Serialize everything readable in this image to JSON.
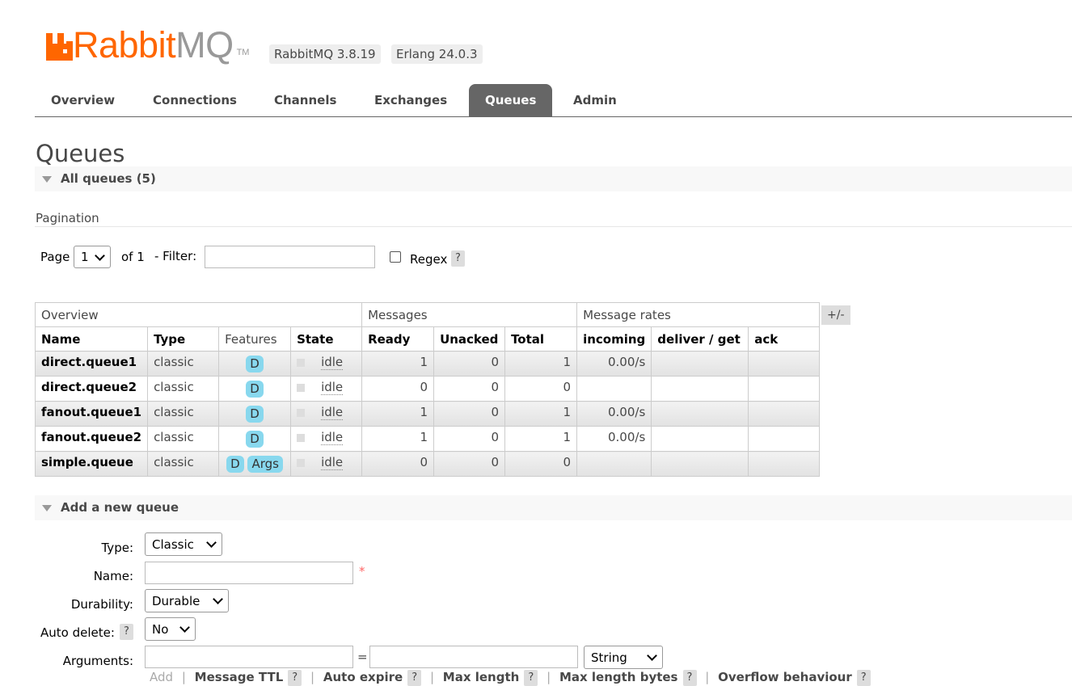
{
  "header": {
    "logo_rabbit": "Rabbit",
    "logo_mq": "MQ",
    "logo_tm": "TM",
    "version_badge": "RabbitMQ 3.8.19",
    "erlang_badge": "Erlang 24.0.3",
    "brand_color": "#ff6600"
  },
  "nav": {
    "tabs": [
      {
        "label": "Overview"
      },
      {
        "label": "Connections"
      },
      {
        "label": "Channels"
      },
      {
        "label": "Exchanges"
      },
      {
        "label": "Queues",
        "active": true
      },
      {
        "label": "Admin"
      }
    ]
  },
  "page_title": "Queues",
  "all_queues": {
    "title": "All queues (5)",
    "pagination_label": "Pagination",
    "page_label": "Page",
    "page_value": "1",
    "of_label": "of 1",
    "filter_label": "- Filter:",
    "filter_value": "",
    "regex_label": "Regex",
    "help": "?",
    "toggle_columns": "+/-",
    "groups": {
      "overview": "Overview",
      "messages": "Messages",
      "rates": "Message rates"
    },
    "columns": {
      "name": "Name",
      "type": "Type",
      "features": "Features",
      "state": "State",
      "ready": "Ready",
      "unacked": "Unacked",
      "total": "Total",
      "incoming": "incoming",
      "deliver": "deliver / get",
      "ack": "ack"
    },
    "rows": [
      {
        "name": "direct.queue1",
        "type": "classic",
        "features": [
          "D"
        ],
        "state": "idle",
        "ready": "1",
        "unacked": "0",
        "total": "1",
        "incoming": "0.00/s",
        "deliver": "",
        "ack": ""
      },
      {
        "name": "direct.queue2",
        "type": "classic",
        "features": [
          "D"
        ],
        "state": "idle",
        "ready": "0",
        "unacked": "0",
        "total": "0",
        "incoming": "",
        "deliver": "",
        "ack": ""
      },
      {
        "name": "fanout.queue1",
        "type": "classic",
        "features": [
          "D"
        ],
        "state": "idle",
        "ready": "1",
        "unacked": "0",
        "total": "1",
        "incoming": "0.00/s",
        "deliver": "",
        "ack": ""
      },
      {
        "name": "fanout.queue2",
        "type": "classic",
        "features": [
          "D"
        ],
        "state": "idle",
        "ready": "1",
        "unacked": "0",
        "total": "1",
        "incoming": "0.00/s",
        "deliver": "",
        "ack": ""
      },
      {
        "name": "simple.queue",
        "type": "classic",
        "features": [
          "D",
          "Args"
        ],
        "state": "idle",
        "ready": "0",
        "unacked": "0",
        "total": "0",
        "incoming": "",
        "deliver": "",
        "ack": ""
      }
    ]
  },
  "add_queue": {
    "title": "Add a new queue",
    "type_label": "Type:",
    "type_value": "Classic",
    "name_label": "Name:",
    "name_value": "",
    "required_mark": "*",
    "durability_label": "Durability:",
    "durability_value": "Durable",
    "auto_delete_label": "Auto delete:",
    "auto_delete_value": "No",
    "arguments_label": "Arguments:",
    "arg_key": "",
    "arg_eq": "=",
    "arg_value": "",
    "arg_type": "String",
    "add_label": "Add",
    "arg_links": [
      "Message TTL",
      "Auto expire",
      "Max length",
      "Max length bytes",
      "Overflow behaviour"
    ]
  }
}
